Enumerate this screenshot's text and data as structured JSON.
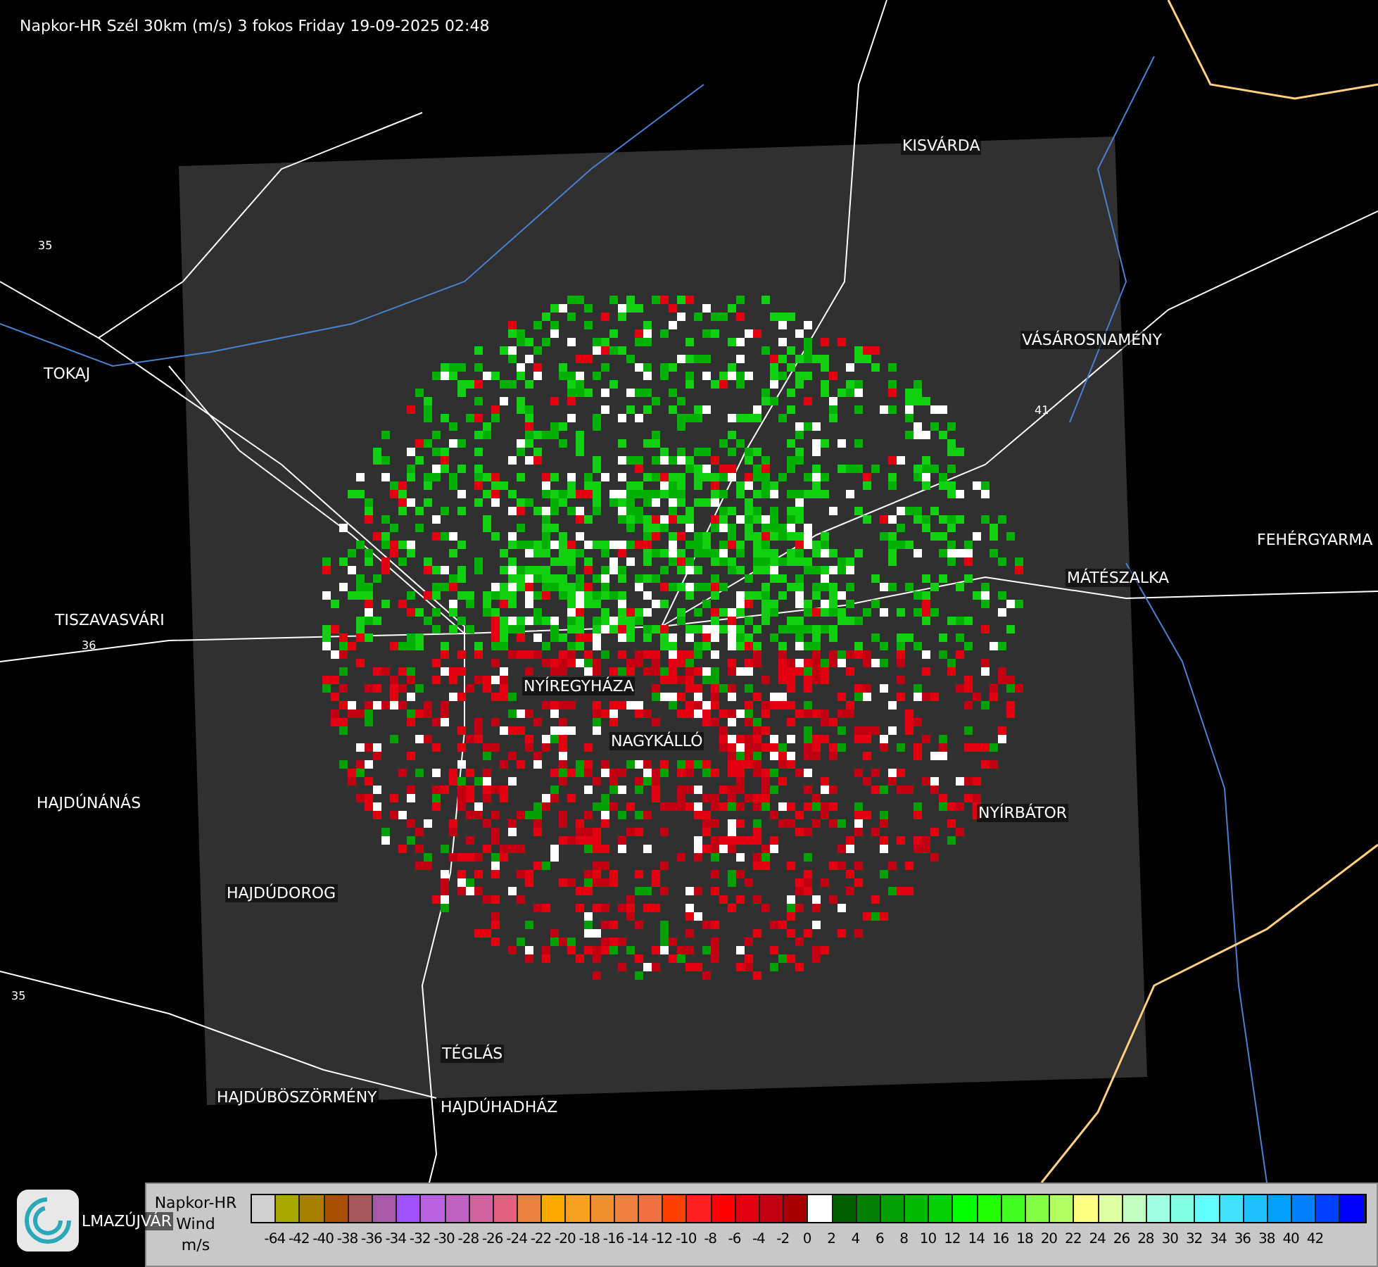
{
  "title": "Napkor-HR Szél 30km (m/s) 3 fokos Friday 19-09-2025 02:48",
  "cities": [
    {
      "name": "KISVÁRDA"
    },
    {
      "name": "VÁSÁROSNAMÉNY"
    },
    {
      "name": "TOKAJ"
    },
    {
      "name": "FEHÉRGYARMA"
    },
    {
      "name": "MÁTÉSZALKA"
    },
    {
      "name": "TISZAVASVÁRI"
    },
    {
      "name": "NYÍREGYHÁZA"
    },
    {
      "name": "NAGYKÁLLÓ"
    },
    {
      "name": "HAJDÚNÁNÁS"
    },
    {
      "name": "NYÍRBÁTOR"
    },
    {
      "name": "HAJDÚDOROG"
    },
    {
      "name": "TÉGLÁS"
    },
    {
      "name": "HAJDÚBÖSZÖRMÉNY"
    },
    {
      "name": "HAJDÚHADHÁZ"
    },
    {
      "name": "LMAZÚJVÁR"
    }
  ],
  "road_numbers": [
    "36",
    "35",
    "41",
    "35"
  ],
  "legend": {
    "title": "Napkor-HR",
    "quantity": "Wind",
    "unit": "m/s",
    "swatches": [
      {
        "color": "#d0d0d0"
      },
      {
        "color": "#a8a800"
      },
      {
        "color": "#a88000"
      },
      {
        "color": "#a85000"
      },
      {
        "color": "#a85858"
      },
      {
        "color": "#a858a8"
      },
      {
        "color": "#a050ff"
      },
      {
        "color": "#b860e0"
      },
      {
        "color": "#c060c0"
      },
      {
        "color": "#d060a0"
      },
      {
        "color": "#e06080"
      },
      {
        "color": "#e88040"
      },
      {
        "color": "#ffa800"
      },
      {
        "color": "#f8a020"
      },
      {
        "color": "#f09030"
      },
      {
        "color": "#f08040"
      },
      {
        "color": "#f07040"
      },
      {
        "color": "#ff4000"
      },
      {
        "color": "#ff2020"
      },
      {
        "color": "#ff0000"
      },
      {
        "color": "#e00010"
      },
      {
        "color": "#c00010"
      },
      {
        "color": "#a80000"
      },
      {
        "color": "#ffffff"
      },
      {
        "color": "#006000"
      },
      {
        "color": "#008000"
      },
      {
        "color": "#00a000"
      },
      {
        "color": "#00b800"
      },
      {
        "color": "#00d000"
      },
      {
        "color": "#00ff00"
      },
      {
        "color": "#20ff00"
      },
      {
        "color": "#40ff20"
      },
      {
        "color": "#80ff40"
      },
      {
        "color": "#b0ff60"
      },
      {
        "color": "#ffff80"
      },
      {
        "color": "#e0ffa0"
      },
      {
        "color": "#c0ffc0"
      },
      {
        "color": "#a0ffe0"
      },
      {
        "color": "#80ffe0"
      },
      {
        "color": "#60ffff"
      },
      {
        "color": "#40e0ff"
      },
      {
        "color": "#20c0ff"
      },
      {
        "color": "#00a0ff"
      },
      {
        "color": "#0080ff"
      },
      {
        "color": "#0040ff"
      },
      {
        "color": "#0000ff"
      }
    ],
    "labels": [
      "-64",
      "-42",
      "-40",
      "-38",
      "-36",
      "-34",
      "-32",
      "-30",
      "-28",
      "-26",
      "-24",
      "-22",
      "-20",
      "-18",
      "-16",
      "-14",
      "-12",
      "-10",
      "-8",
      "-6",
      "-4",
      "-2",
      "0",
      "2",
      "4",
      "6",
      "8",
      "10",
      "12",
      "14",
      "16",
      "18",
      "20",
      "22",
      "24",
      "26",
      "28",
      "30",
      "32",
      "34",
      "36",
      "38",
      "40",
      "42"
    ]
  }
}
